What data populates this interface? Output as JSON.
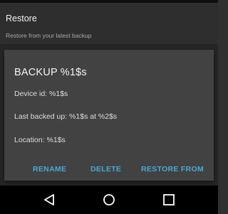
{
  "header": {
    "title": "Restore",
    "subtitle": "Restore from your latest backup"
  },
  "dialog": {
    "title": "BACKUP %1$s",
    "device_id": "Device id: %1$s",
    "last_backed_up": "Last backed up: %1$s at %2$s",
    "location": "Location: %1$s",
    "buttons": {
      "rename": "RENAME",
      "delete": "DELETE",
      "restore_from": "RESTORE FROM"
    }
  },
  "colors": {
    "accent": "#4aa8d8",
    "dialog_bg": "#424242",
    "nav_bg": "#000000"
  },
  "navigation": {
    "back_icon": "triangle-back-icon",
    "home_icon": "circle-home-icon",
    "recents_icon": "square-recents-icon"
  }
}
